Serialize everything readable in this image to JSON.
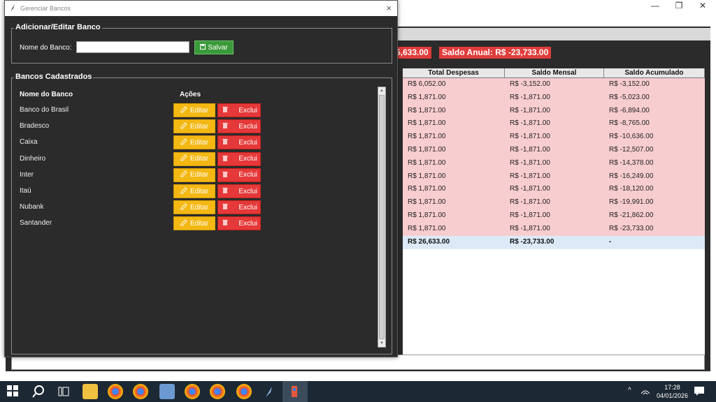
{
  "dialog": {
    "title": "Gerenciar Bancos",
    "close_icon": "×",
    "edit_group": {
      "legend": "Adicionar/Editar Banco",
      "field_label": "Nome do Banco:",
      "field_value": "",
      "save_label": "Salvar"
    },
    "list_group": {
      "legend": "Bancos Cadastrados",
      "col_name": "Nome do Banco",
      "col_actions": "Ações",
      "edit_label": "Editar",
      "delete_label": "Exclui",
      "banks": [
        "Banco do Brasil",
        "Bradesco",
        "Caixa",
        "Dinheiro",
        "Inter",
        "Itaú",
        "Nubank",
        "Santander"
      ]
    }
  },
  "background": {
    "summary_mensal": "5,633.00",
    "summary_anual": "Saldo Anual: R$ -23,733.00",
    "table": {
      "headers": [
        "Total Despesas",
        "Saldo Mensal",
        "Saldo Acumulado"
      ],
      "rows": [
        [
          "R$ 6,052.00",
          "R$ -3,152.00",
          "R$ -3,152.00"
        ],
        [
          "R$ 1,871.00",
          "R$ -1,871.00",
          "R$ -5,023.00"
        ],
        [
          "R$ 1,871.00",
          "R$ -1,871.00",
          "R$ -6,894.00"
        ],
        [
          "R$ 1,871.00",
          "R$ -1,871.00",
          "R$ -8,765.00"
        ],
        [
          "R$ 1,871.00",
          "R$ -1,871.00",
          "R$ -10,636.00"
        ],
        [
          "R$ 1,871.00",
          "R$ -1,871.00",
          "R$ -12,507.00"
        ],
        [
          "R$ 1,871.00",
          "R$ -1,871.00",
          "R$ -14,378.00"
        ],
        [
          "R$ 1,871.00",
          "R$ -1,871.00",
          "R$ -16,249.00"
        ],
        [
          "R$ 1,871.00",
          "R$ -1,871.00",
          "R$ -18,120.00"
        ],
        [
          "R$ 1,871.00",
          "R$ -1,871.00",
          "R$ -19,991.00"
        ],
        [
          "R$ 1,871.00",
          "R$ -1,871.00",
          "R$ -21,862.00"
        ],
        [
          "R$ 1,871.00",
          "R$ -1,871.00",
          "R$ -23,733.00"
        ]
      ],
      "total": [
        "R$ 26,633.00",
        "R$ -23,733.00",
        "-"
      ]
    },
    "window_controls": [
      "—",
      "❐",
      "✕"
    ]
  },
  "taskbar": {
    "time": "17:28",
    "date": "04/01/2026"
  },
  "colors": {
    "save_green": "#3a9a3a",
    "edit_yellow": "#f4b814",
    "delete_red": "#e53838",
    "dialog_bg": "#2b2b2b",
    "row_pink": "#f8cdd0"
  }
}
